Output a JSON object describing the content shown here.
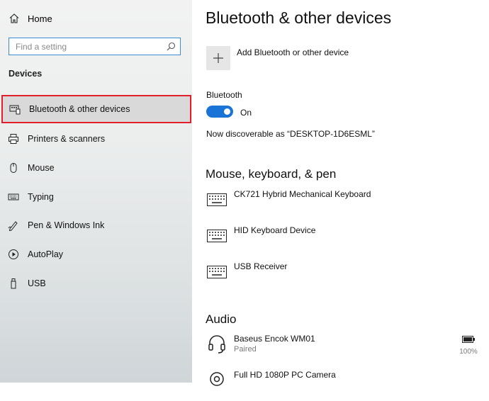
{
  "sidebar": {
    "home_label": "Home",
    "search_placeholder": "Find a setting",
    "section_title": "Devices",
    "items": [
      {
        "label": "Bluetooth & other devices",
        "icon": "bluetooth-devices-icon",
        "selected": true
      },
      {
        "label": "Printers & scanners",
        "icon": "printer-icon"
      },
      {
        "label": "Mouse",
        "icon": "mouse-icon"
      },
      {
        "label": "Typing",
        "icon": "keyboard-icon"
      },
      {
        "label": "Pen & Windows Ink",
        "icon": "pen-icon"
      },
      {
        "label": "AutoPlay",
        "icon": "autoplay-icon"
      },
      {
        "label": "USB",
        "icon": "usb-icon"
      }
    ]
  },
  "main": {
    "title": "Bluetooth & other devices",
    "add_device_label": "Add Bluetooth or other device",
    "bluetooth_label": "Bluetooth",
    "bluetooth_state": "On",
    "discoverable_text": "Now discoverable as “DESKTOP-1D6ESML”",
    "mouse_section_title": "Mouse, keyboard, & pen",
    "input_devices": [
      {
        "name": "CK721 Hybrid Mechanical Keyboard",
        "icon": "keyboard-icon"
      },
      {
        "name": "HID Keyboard Device",
        "icon": "keyboard-icon"
      },
      {
        "name": "USB Receiver",
        "icon": "keyboard-icon"
      }
    ],
    "audio_section_title": "Audio",
    "audio_devices": [
      {
        "name": "Baseus Encok WM01",
        "status": "Paired",
        "battery": "100%",
        "icon": "headset-icon"
      },
      {
        "name": "Full HD 1080P PC Camera",
        "icon": "webcam-icon"
      }
    ]
  },
  "colors": {
    "accent": "#1a73d6",
    "selection_border": "#e0202a"
  }
}
